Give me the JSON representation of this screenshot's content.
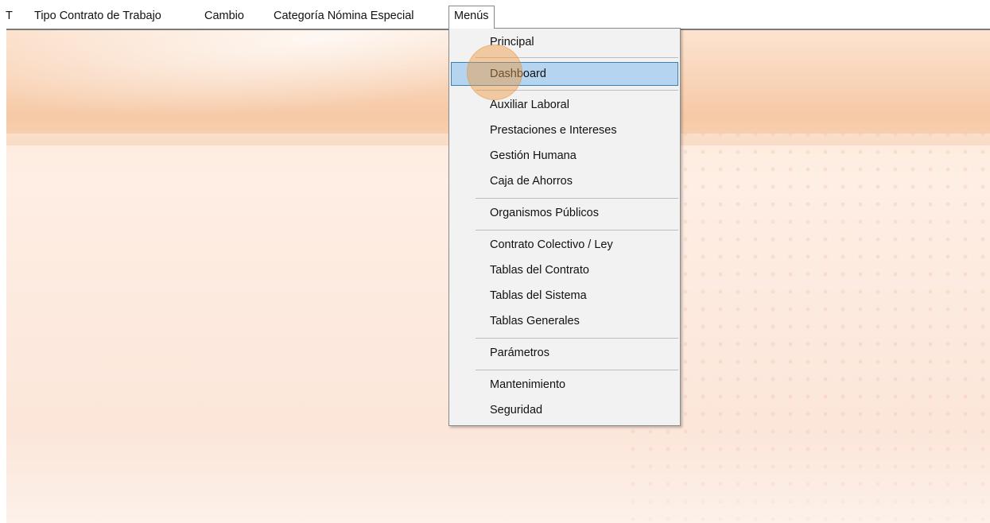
{
  "menubar": {
    "items": [
      "T",
      "Tipo Contrato de Trabajo",
      "Cambio",
      "Categoría Nómina Especial",
      "Menús"
    ]
  },
  "menus_dropdown": {
    "items": [
      {
        "label": "Principal"
      },
      {
        "label": "Dashboard",
        "highlighted": true
      },
      {
        "label": "Auxiliar Laboral"
      },
      {
        "label": "Prestaciones e Intereses"
      },
      {
        "label": "Gestión Humana"
      },
      {
        "label": "Caja de Ahorros"
      },
      {
        "label": "Organismos Públicos"
      },
      {
        "label": "Contrato Colectivo / Ley"
      },
      {
        "label": "Tablas del Contrato"
      },
      {
        "label": "Tablas del Sistema"
      },
      {
        "label": "Tablas Generales"
      },
      {
        "label": "Parámetros"
      },
      {
        "label": "Mantenimiento"
      },
      {
        "label": "Seguridad"
      }
    ]
  },
  "colors": {
    "highlight": "#b5d4ef",
    "highlight_border": "#3c7fb1",
    "click_marker": "#ee963c",
    "background_band": "#f6c9a6"
  }
}
